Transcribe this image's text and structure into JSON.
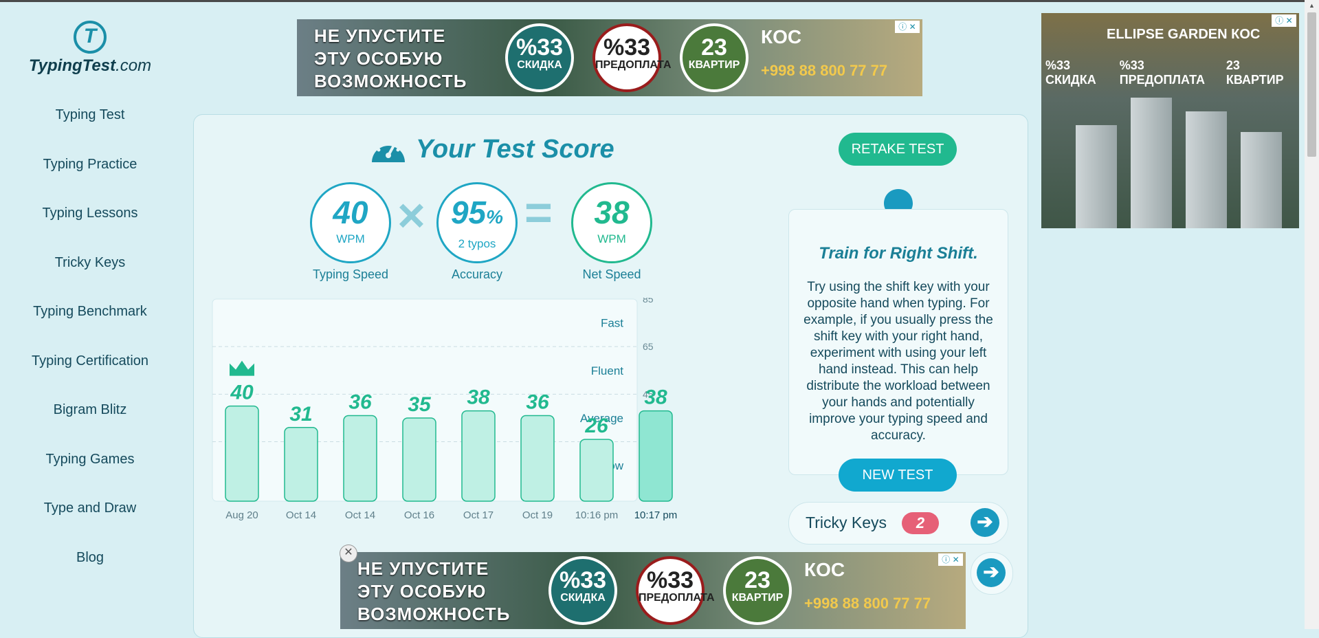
{
  "site": {
    "brand_bold": "TypingTest",
    "brand_suffix": ".com",
    "logo_letter": "T"
  },
  "nav": [
    "Typing Test",
    "Typing Practice",
    "Typing Lessons",
    "Tricky Keys",
    "Typing Benchmark",
    "Typing Certification",
    "Bigram Blitz",
    "Typing Games",
    "Type and Draw",
    "Blog"
  ],
  "ad_banner": {
    "headline_lines": [
      "НЕ УПУСТИТЕ",
      "ЭТУ ОСОБУЮ",
      "ВОЗМОЖНОСТЬ"
    ],
    "circles": [
      {
        "big": "%33",
        "small": "СКИДКА"
      },
      {
        "big": "%33",
        "small": "ПРЕДОПЛАТА"
      },
      {
        "big": "23",
        "small": "КВАРТИР"
      }
    ],
    "brand": "КОС",
    "phone": "+998 88 800 77 77",
    "info": "ⓘ ✕",
    "close": "✕"
  },
  "ad_side": {
    "brand": "ELLIPSE GARDEN  КОС",
    "row": [
      "%33 СКИДКА",
      "%33 ПРЕДОПЛАТА",
      "23 КВАРТИР"
    ],
    "info": "ⓘ ✕"
  },
  "score": {
    "title": "Your Test Score",
    "retake_label": "RETAKE TEST",
    "speed": {
      "value": "40",
      "unit": "WPM",
      "label": "Typing Speed"
    },
    "accuracy": {
      "value": "95",
      "pct": "%",
      "unit": "2 typos",
      "label": "Accuracy"
    },
    "net": {
      "value": "38",
      "unit": "WPM",
      "label": "Net Speed"
    },
    "times": "×",
    "equals": "="
  },
  "chart_data": {
    "type": "bar",
    "categories": [
      "Aug 20",
      "Oct 14",
      "Oct 14",
      "Oct 16",
      "Oct 17",
      "Oct 19",
      "10:16 pm",
      "10:17 pm"
    ],
    "values": [
      40,
      31,
      36,
      35,
      38,
      36,
      26,
      38
    ],
    "best_index": 0,
    "current_index": 7,
    "ylim": [
      0,
      85
    ],
    "yticks": [
      25,
      45,
      65,
      85
    ],
    "bands": [
      "Slow",
      "Average",
      "Fluent",
      "Fast"
    ],
    "grid": true,
    "colors": {
      "bar": "#bff0e4",
      "bar_current": "#8fe6d2",
      "bar_border": "#21b98f",
      "label": "#21b98f"
    }
  },
  "tip": {
    "title": "Train for Right Shift.",
    "body": "Try using the shift key with your opposite hand when typing. For example, if you usually press the shift key with your right hand, experiment with using your left hand instead. This can help distribute the workload between your hands and potentially improve your typing speed and accuracy.",
    "new_test_label": "NEW TEST"
  },
  "tricky": {
    "label": "Tricky Keys",
    "count": "2",
    "arrow": "➔"
  },
  "icons": [
    "gauge-icon",
    "lightbulb-icon",
    "crown-icon",
    "arrow-right-icon"
  ]
}
